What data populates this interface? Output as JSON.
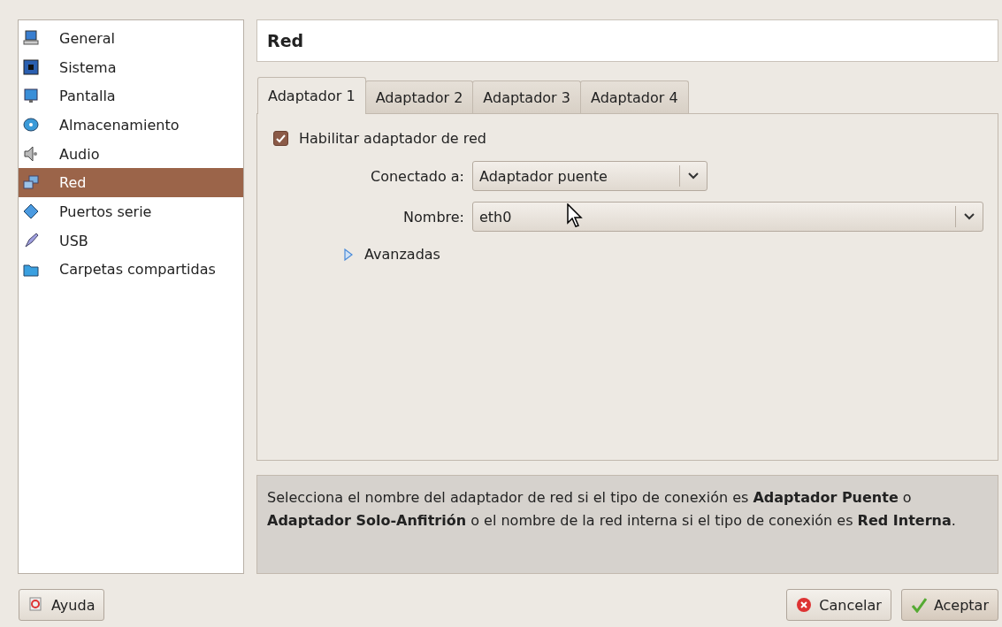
{
  "sidebar": {
    "items": [
      {
        "label": "General",
        "selected": false
      },
      {
        "label": "Sistema",
        "selected": false
      },
      {
        "label": "Pantalla",
        "selected": false
      },
      {
        "label": "Almacenamiento",
        "selected": false
      },
      {
        "label": "Audio",
        "selected": false
      },
      {
        "label": "Red",
        "selected": true
      },
      {
        "label": "Puertos serie",
        "selected": false
      },
      {
        "label": "USB",
        "selected": false
      },
      {
        "label": "Carpetas compartidas",
        "selected": false
      }
    ]
  },
  "page_title": "Red",
  "tabs": [
    {
      "label": "Adaptador 1",
      "selected": true
    },
    {
      "label": "Adaptador 2",
      "selected": false
    },
    {
      "label": "Adaptador 3",
      "selected": false
    },
    {
      "label": "Adaptador 4",
      "selected": false
    }
  ],
  "enable_adapter": {
    "label": "Habilitar adaptador de red",
    "checked": true
  },
  "attached_to": {
    "label": "Conectado a:",
    "value": "Adaptador puente"
  },
  "name": {
    "label": "Nombre:",
    "value": "eth0"
  },
  "advanced": {
    "label": "Avanzadas",
    "expanded": false
  },
  "info": "Selecciona el nombre del adaptador de red si el tipo de conexión es **Adaptador Puente** o **Adaptador Solo-Anfitrión** o el nombre de la red interna si el tipo de conexión es **Red Interna**.",
  "buttons": [
    {
      "label": "Ayuda",
      "kind": "help"
    },
    {
      "label": "Cancelar",
      "kind": "cancel"
    },
    {
      "label": "Aceptar",
      "kind": "ok"
    }
  ]
}
